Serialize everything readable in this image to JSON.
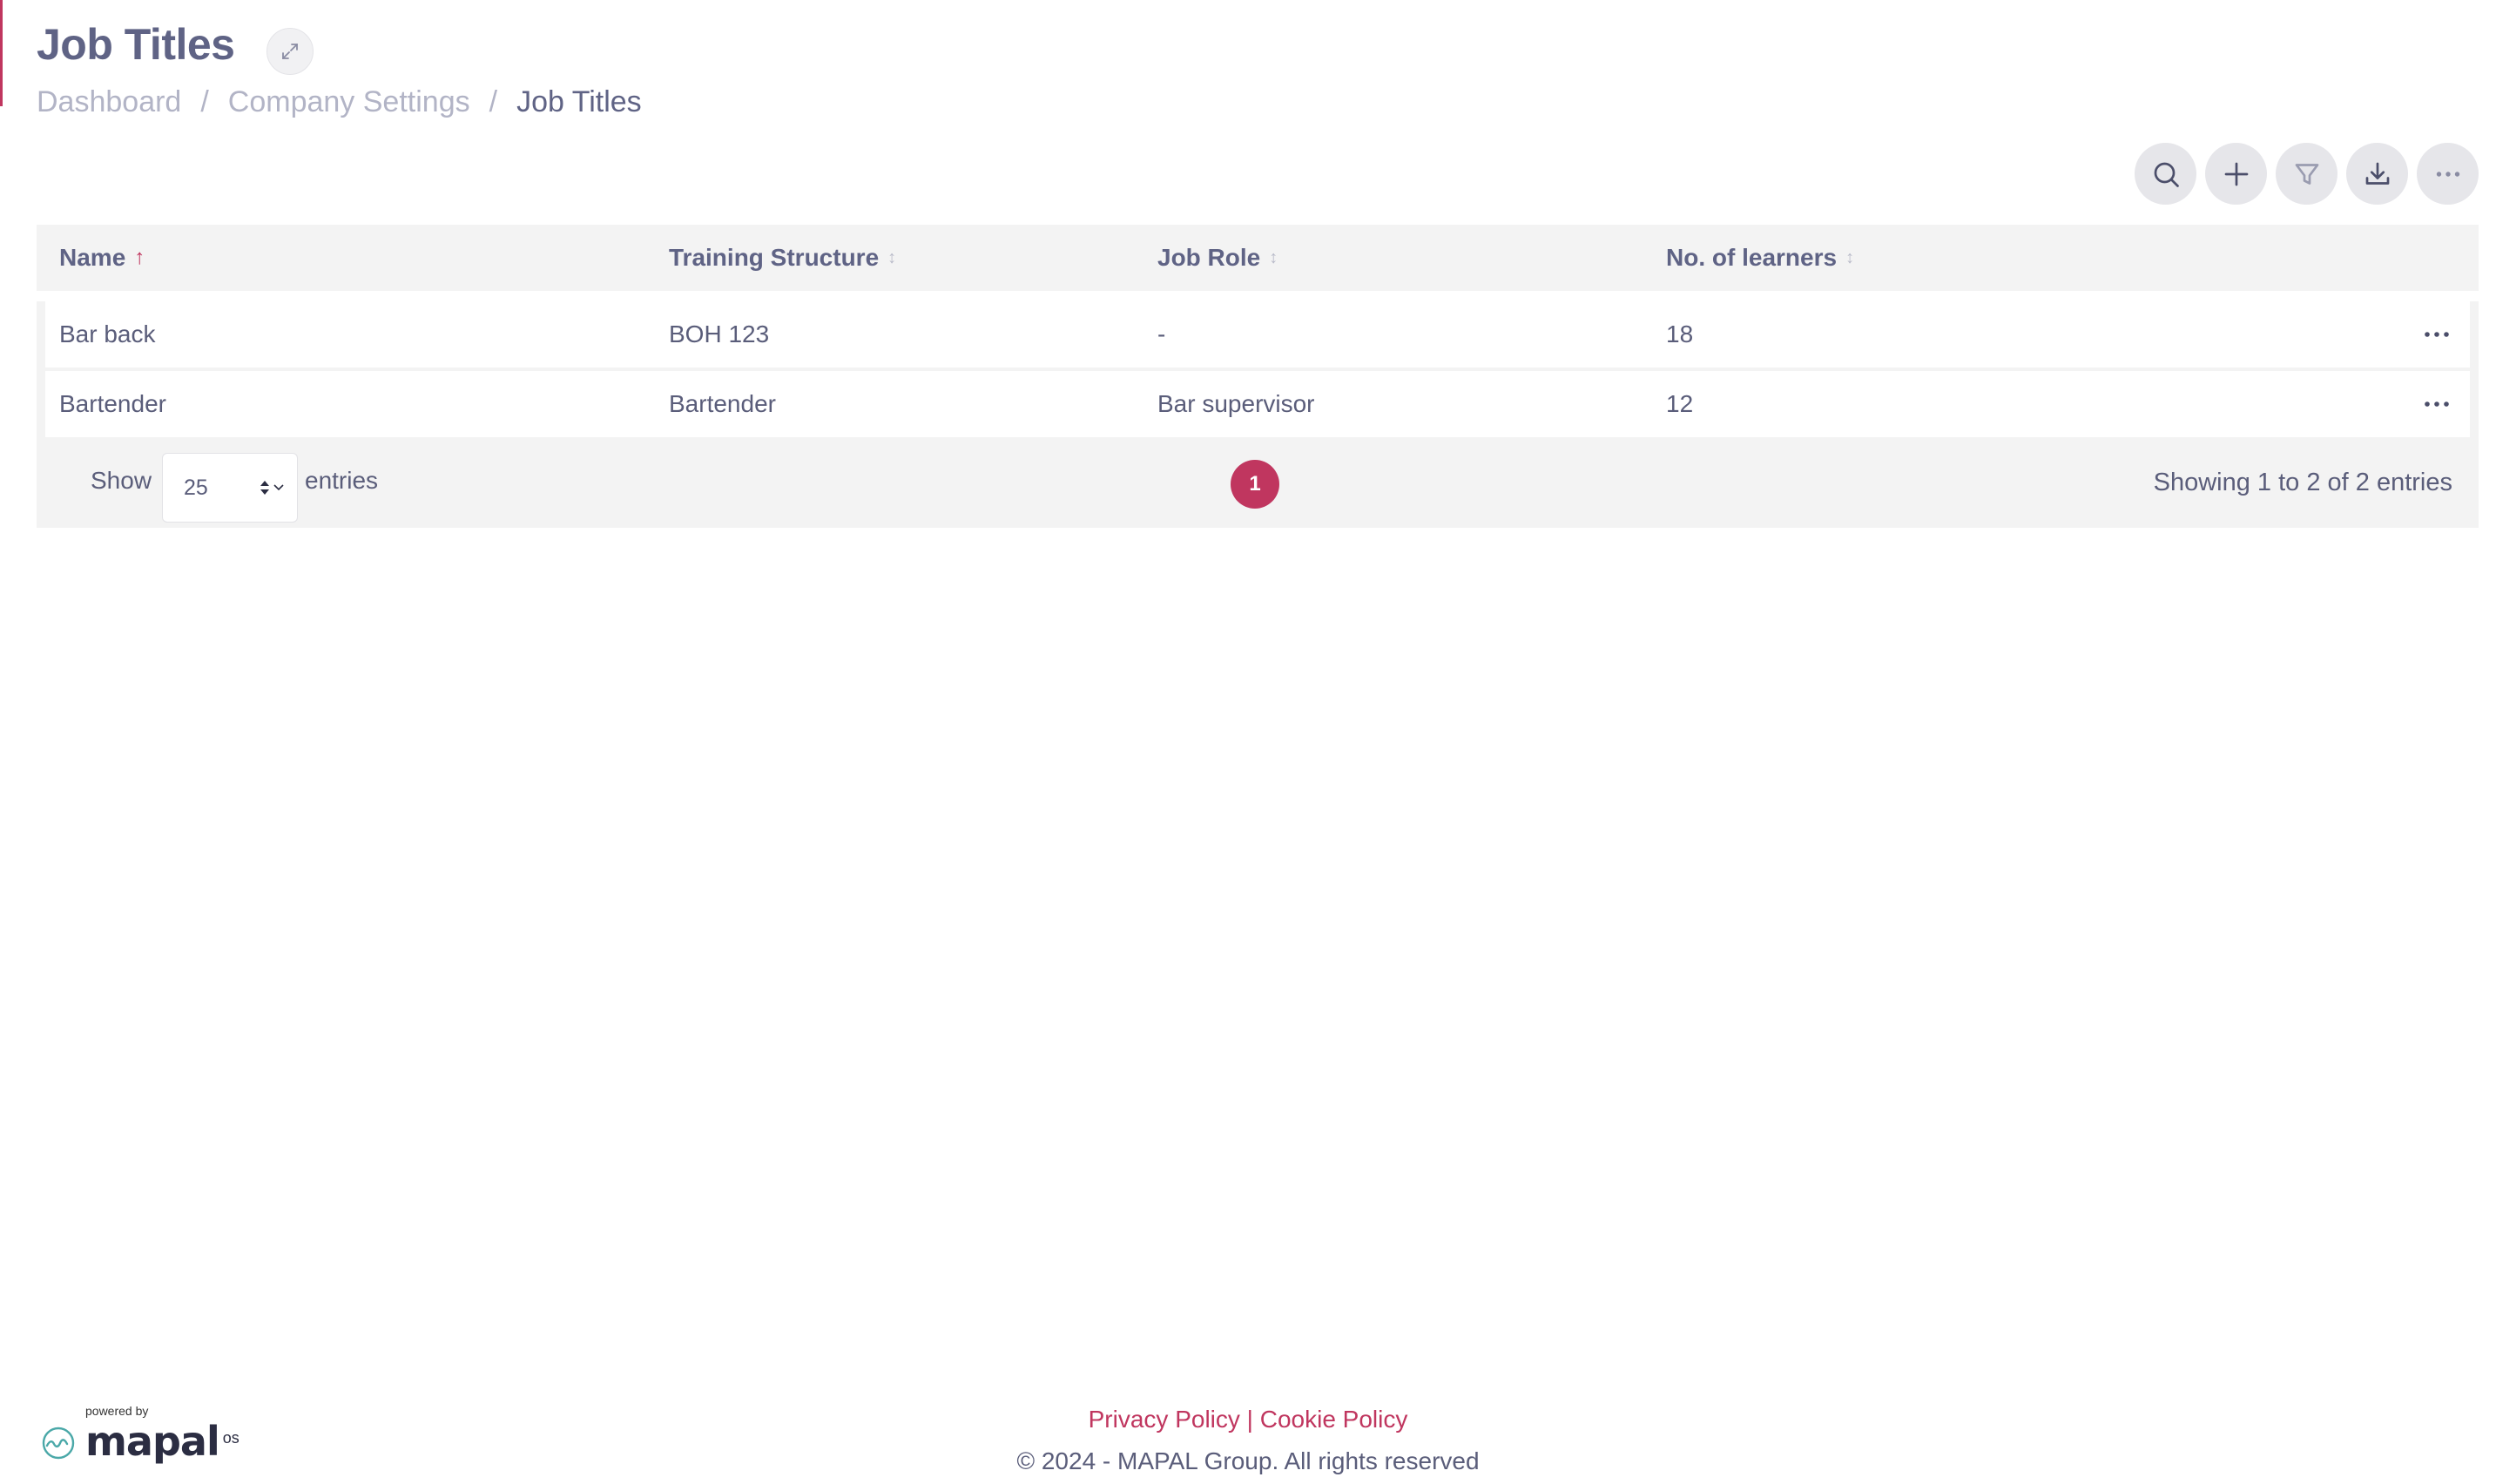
{
  "header": {
    "title": "Job Titles"
  },
  "breadcrumb": {
    "items": [
      "Dashboard",
      "Company Settings",
      "Job Titles"
    ],
    "separator": "/"
  },
  "toolbar": {
    "buttons": [
      "search-icon",
      "plus-icon",
      "filter-icon",
      "download-icon",
      "more-icon"
    ]
  },
  "table": {
    "columns": [
      {
        "label": "Name",
        "sort": "asc"
      },
      {
        "label": "Training Structure",
        "sort": "none"
      },
      {
        "label": "Job Role",
        "sort": "none"
      },
      {
        "label": "No. of learners",
        "sort": "none"
      }
    ],
    "sort_asc_glyph": "↑",
    "sort_none_glyph": "↕",
    "rows": [
      {
        "name": "Bar back",
        "training_structure": "BOH 123",
        "job_role": "-",
        "learners": "18"
      },
      {
        "name": "Bartender",
        "training_structure": "Bartender",
        "job_role": "Bar supervisor",
        "learners": "12"
      }
    ]
  },
  "pagination": {
    "show_label": "Show",
    "page_size": "25",
    "entries_label": "entries",
    "current_page": "1",
    "summary": "Showing 1 to 2 of 2 entries"
  },
  "footer": {
    "privacy": "Privacy Policy",
    "divider": "|",
    "cookie": "Cookie Policy",
    "copyright": "© 2024 - MAPAL Group. All rights reserved"
  },
  "brand": {
    "powered_by": "powered by",
    "name": "mapal",
    "suffix": "os"
  },
  "colors": {
    "accent": "#c0365f",
    "text": "#5a5d7a",
    "muted": "#b2b4c6",
    "table_bg": "#f3f3f3"
  }
}
